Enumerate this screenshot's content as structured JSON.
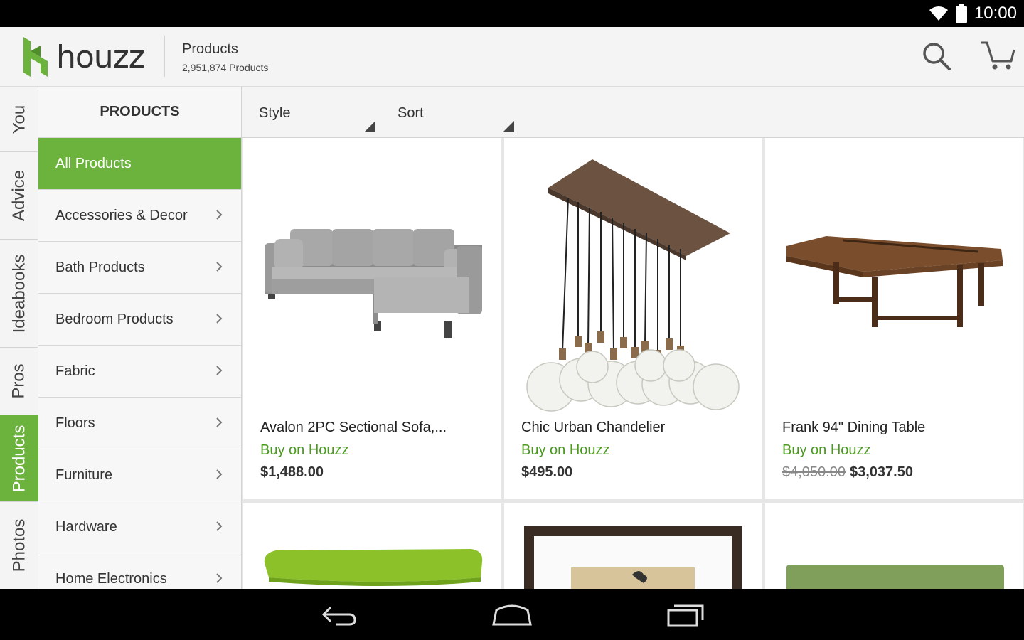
{
  "status": {
    "time": "10:00"
  },
  "appbar": {
    "logo_text": "houzz",
    "title": "Products",
    "subtitle": "2,951,874 Products"
  },
  "nav_tabs": [
    "You",
    "Advice",
    "Ideabooks",
    "Pros",
    "Products",
    "Photos"
  ],
  "categories": {
    "header": "PRODUCTS",
    "items": [
      "All Products",
      "Accessories & Decor",
      "Bath Products",
      "Bedroom Products",
      "Fabric",
      "Floors",
      "Furniture",
      "Hardware",
      "Home Electronics"
    ]
  },
  "filters": {
    "style": "Style",
    "sort": "Sort"
  },
  "products": [
    {
      "name": "Avalon 2PC Sectional Sofa,...",
      "buy": "Buy on Houzz",
      "old_price": "",
      "price": "$1,488.00"
    },
    {
      "name": "Chic Urban Chandelier",
      "buy": "Buy on Houzz",
      "old_price": "",
      "price": "$495.00"
    },
    {
      "name": "Frank 94\" Dining Table",
      "buy": "Buy on Houzz",
      "old_price": "$4,050.00",
      "price": "$3,037.50"
    }
  ],
  "colors": {
    "accent": "#6cb33e",
    "buy_link": "#4a9a1d"
  }
}
